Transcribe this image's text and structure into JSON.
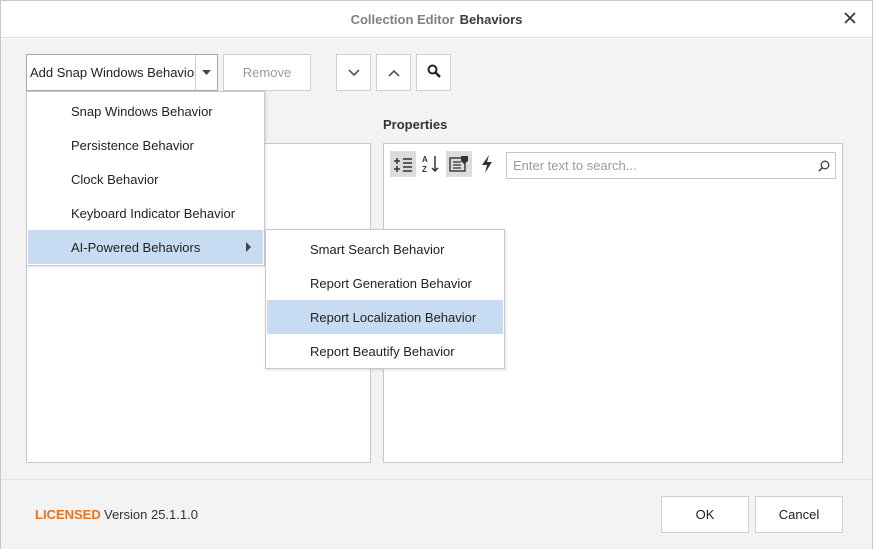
{
  "window": {
    "title_prefix": "Collection Editor",
    "title_main": "Behaviors"
  },
  "toolbar": {
    "add_combo_value": "Add Snap Windows Behavior",
    "remove_label": "Remove",
    "move_down_icon": "chevron-down-icon",
    "move_up_icon": "chevron-up-icon",
    "find_icon": "search-icon"
  },
  "properties": {
    "label": "Properties",
    "search_placeholder": "Enter text to search...",
    "toolbar_icons": [
      "categorized-icon",
      "alphabetical-icon",
      "property-pages-icon",
      "events-icon"
    ]
  },
  "add_menu": {
    "items": [
      {
        "label": "Snap Windows Behavior",
        "highlighted": false,
        "has_submenu": false
      },
      {
        "label": "Persistence Behavior",
        "highlighted": false,
        "has_submenu": false
      },
      {
        "label": "Clock Behavior",
        "highlighted": false,
        "has_submenu": false
      },
      {
        "label": "Keyboard Indicator Behavior",
        "highlighted": false,
        "has_submenu": false
      },
      {
        "label": "AI-Powered Behaviors",
        "highlighted": true,
        "has_submenu": true
      }
    ]
  },
  "ai_submenu": {
    "items": [
      {
        "label": "Smart Search Behavior",
        "highlighted": false
      },
      {
        "label": "Report Generation Behavior",
        "highlighted": false
      },
      {
        "label": "Report Localization Behavior",
        "highlighted": true
      },
      {
        "label": "Report Beautify Behavior",
        "highlighted": false
      }
    ]
  },
  "footer": {
    "licensed": "LICENSED",
    "version": "Version 25.1.1.0",
    "ok_label": "OK",
    "cancel_label": "Cancel"
  },
  "colors": {
    "highlight": "#c7dbf2",
    "licensed": "#e8731c",
    "background": "#f3f3f3"
  }
}
